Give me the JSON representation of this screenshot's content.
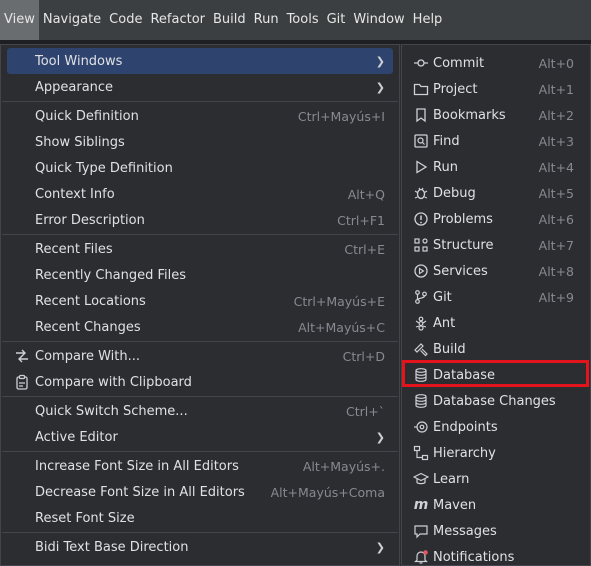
{
  "menubar": [
    "View",
    "Navigate",
    "Code",
    "Refactor",
    "Build",
    "Run",
    "Tools",
    "Git",
    "Window",
    "Help"
  ],
  "view_menu": {
    "tool_windows": "Tool Windows",
    "appearance": "Appearance",
    "quick_definition": {
      "label": "Quick Definition",
      "shortcut": "Ctrl+Mayús+I"
    },
    "show_siblings": "Show Siblings",
    "quick_type_definition": "Quick Type Definition",
    "context_info": {
      "label": "Context Info",
      "shortcut": "Alt+Q"
    },
    "error_description": {
      "label": "Error Description",
      "shortcut": "Ctrl+F1"
    },
    "recent_files": {
      "label": "Recent Files",
      "shortcut": "Ctrl+E"
    },
    "recently_changed_files": "Recently Changed Files",
    "recent_locations": {
      "label": "Recent Locations",
      "shortcut": "Ctrl+Mayús+E"
    },
    "recent_changes": {
      "label": "Recent Changes",
      "shortcut": "Alt+Mayús+C"
    },
    "compare_with": {
      "label": "Compare With...",
      "shortcut": "Ctrl+D"
    },
    "compare_clipboard": "Compare with Clipboard",
    "quick_switch": {
      "label": "Quick Switch Scheme...",
      "shortcut": "Ctrl+`"
    },
    "active_editor": "Active Editor",
    "increase_font": {
      "label": "Increase Font Size in All Editors",
      "shortcut": "Alt+Mayús+."
    },
    "decrease_font": {
      "label": "Decrease Font Size in All Editors",
      "shortcut": "Alt+Mayús+Coma"
    },
    "reset_font": "Reset Font Size",
    "bidi": "Bidi Text Base Direction"
  },
  "tool_windows_menu": [
    {
      "label": "Commit",
      "shortcut": "Alt+0",
      "icon": "commit-icon"
    },
    {
      "label": "Project",
      "shortcut": "Alt+1",
      "icon": "folder-icon"
    },
    {
      "label": "Bookmarks",
      "shortcut": "Alt+2",
      "icon": "bookmark-icon"
    },
    {
      "label": "Find",
      "shortcut": "Alt+3",
      "icon": "search-icon"
    },
    {
      "label": "Run",
      "shortcut": "Alt+4",
      "icon": "run-icon"
    },
    {
      "label": "Debug",
      "shortcut": "Alt+5",
      "icon": "bug-icon"
    },
    {
      "label": "Problems",
      "shortcut": "Alt+6",
      "icon": "problems-icon"
    },
    {
      "label": "Structure",
      "shortcut": "Alt+7",
      "icon": "structure-icon"
    },
    {
      "label": "Services",
      "shortcut": "Alt+8",
      "icon": "services-icon"
    },
    {
      "label": "Git",
      "shortcut": "Alt+9",
      "icon": "git-icon"
    },
    {
      "label": "Ant",
      "shortcut": "",
      "icon": "ant-icon"
    },
    {
      "label": "Build",
      "shortcut": "",
      "icon": "build-icon"
    },
    {
      "label": "Database",
      "shortcut": "",
      "icon": "database-icon"
    },
    {
      "label": "Database Changes",
      "shortcut": "",
      "icon": "database-changes-icon"
    },
    {
      "label": "Endpoints",
      "shortcut": "",
      "icon": "endpoints-icon"
    },
    {
      "label": "Hierarchy",
      "shortcut": "",
      "icon": "hierarchy-icon"
    },
    {
      "label": "Learn",
      "shortcut": "",
      "icon": "learn-icon"
    },
    {
      "label": "Maven",
      "shortcut": "",
      "icon": "maven-icon"
    },
    {
      "label": "Messages",
      "shortcut": "",
      "icon": "messages-icon"
    },
    {
      "label": "Notifications",
      "shortcut": "",
      "icon": "notifications-icon"
    }
  ],
  "colors": {
    "highlight": "#e3141b",
    "selected": "#2e436e"
  }
}
